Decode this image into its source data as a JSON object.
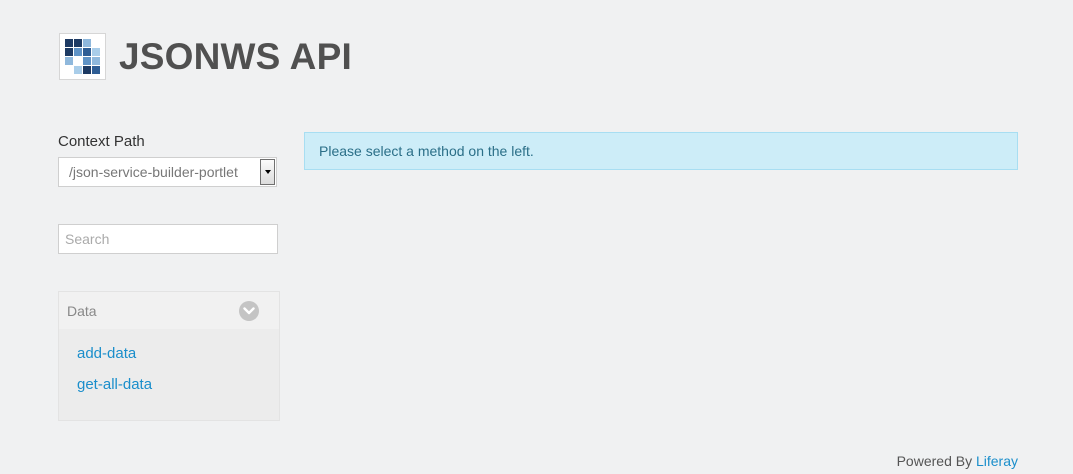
{
  "header": {
    "title": "JSONWS API",
    "logo_icon": "liferay-logo-icon"
  },
  "context": {
    "label": "Context Path",
    "selected": "/json-service-builder-portlet"
  },
  "search": {
    "placeholder": "Search"
  },
  "panel": {
    "title": "Data",
    "methods": [
      "add-data",
      "get-all-data"
    ]
  },
  "alert": {
    "message": "Please select a method on the left."
  },
  "footer": {
    "prefix": "Powered By",
    "link": "Liferay"
  },
  "colors": {
    "background": "#f0f1f2",
    "link": "#1a8ecb",
    "alert_bg": "#cdedf8",
    "alert_text": "#2b6f88",
    "title": "#505050"
  }
}
